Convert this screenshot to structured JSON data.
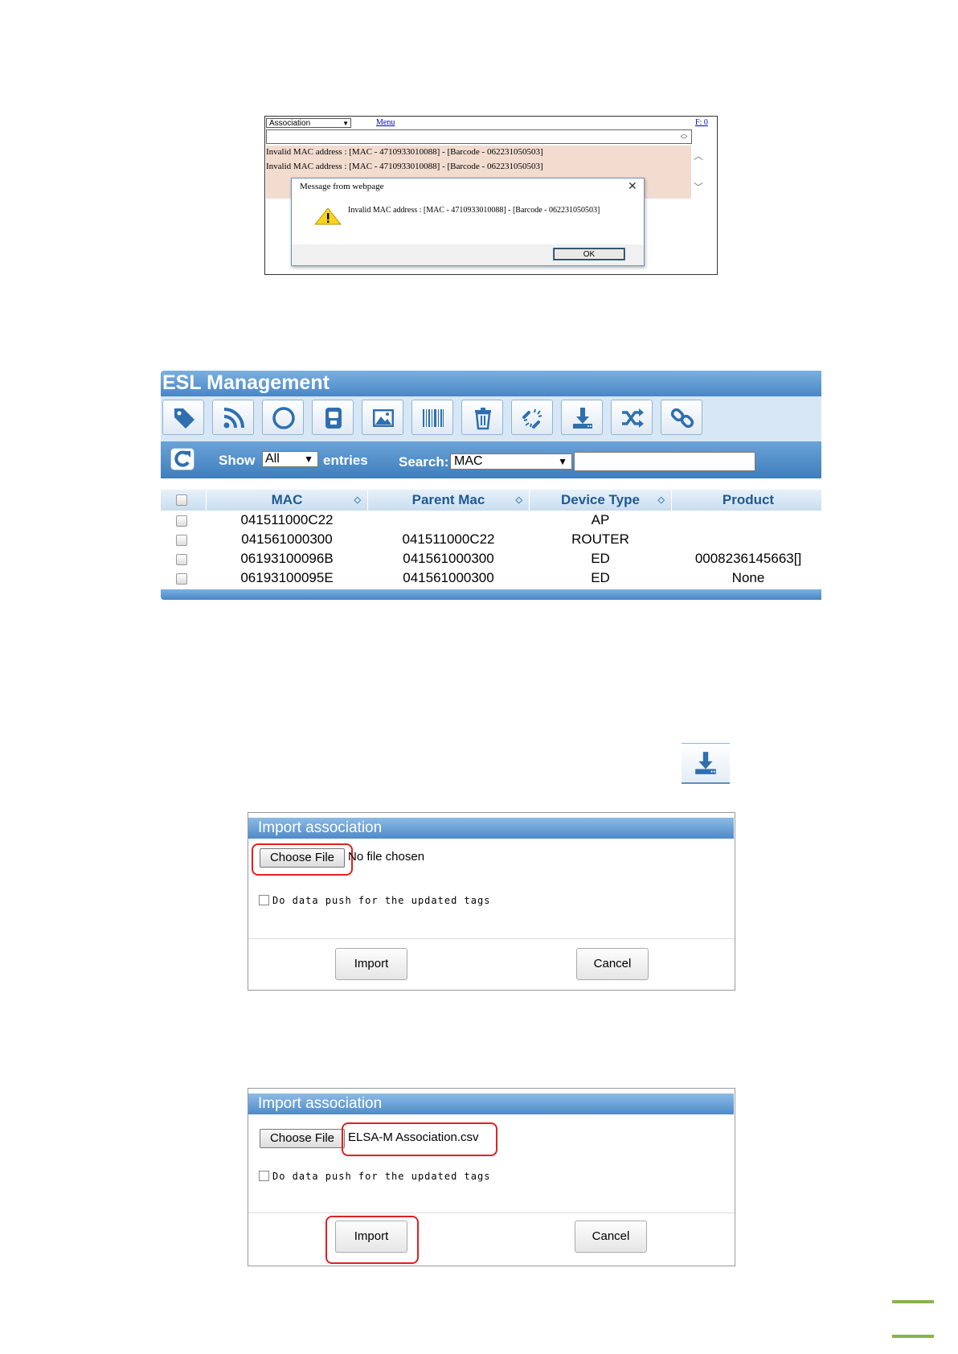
{
  "message_shot": {
    "select_value": "Association",
    "menu_link": "Menu",
    "fx_link": "F: 0",
    "messages": [
      "Invalid MAC address : [MAC - 4710933010088] - [Barcode - 062231050503]",
      "Invalid MAC address : [MAC - 4710933010088] - [Barcode - 062231050503]"
    ],
    "dialog": {
      "title": "Message from webpage",
      "close": "✕",
      "text": "Invalid MAC address : [MAC - 4710933010088] - [Barcode - 062231050503]",
      "ok_label": "OK"
    }
  },
  "esl": {
    "title": "ESL Management",
    "toolbar_icons": [
      "tag-icon",
      "rss-icon",
      "circle-icon",
      "tag-device-icon",
      "image-icon",
      "barcode-icon",
      "trash-icon",
      "unlink-icon",
      "import-icon",
      "shuffle-icon",
      "link-icon"
    ],
    "show_label": "Show",
    "entries_value": "All",
    "entries_label": "entries",
    "search_label": "Search:",
    "search_field": "MAC",
    "columns": [
      "MAC",
      "Parent Mac",
      "Device Type",
      "Product"
    ],
    "rows": [
      {
        "mac": "041511000C22",
        "parent": "",
        "type": "AP",
        "product": ""
      },
      {
        "mac": "041561000300",
        "parent": "041511000C22",
        "type": "ROUTER",
        "product": ""
      },
      {
        "mac": "06193100096B",
        "parent": "041561000300",
        "type": "ED",
        "product": "0008236145663[]"
      },
      {
        "mac": "06193100095E",
        "parent": "041561000300",
        "type": "ED",
        "product": "None"
      }
    ]
  },
  "import_before": {
    "title": "Import association",
    "choose_label": "Choose File",
    "file_text": "No file chosen",
    "push_label": "Do data push for the updated tags",
    "import_label": "Import",
    "cancel_label": "Cancel"
  },
  "import_after": {
    "title": "Import association",
    "choose_label": "Choose File",
    "file_text": "ELSA-M Association.csv",
    "push_label": "Do data push for the updated tags",
    "import_label": "Import",
    "cancel_label": "Cancel"
  },
  "colors": {
    "accent": "#4a86c6",
    "highlight": "#e02020",
    "footer_green": "#8ab34a"
  }
}
